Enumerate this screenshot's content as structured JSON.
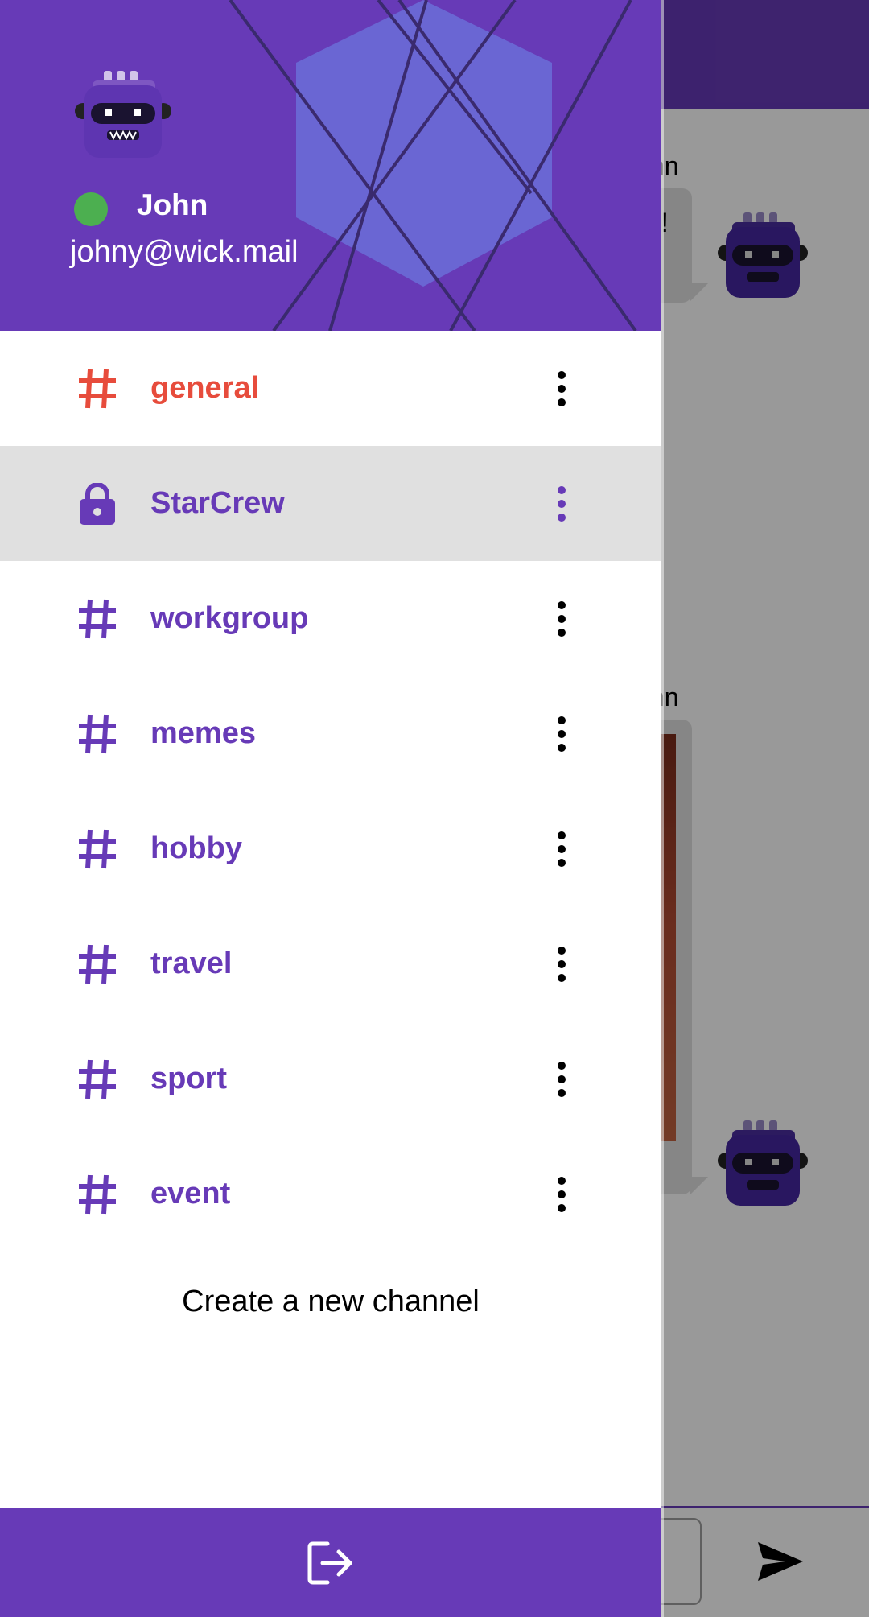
{
  "user": {
    "name": "John",
    "email": "johny@wick.mail",
    "status": "online",
    "avatar_icon": "robot-avatar-icon"
  },
  "channels": [
    {
      "label": "general",
      "icon": "hashtag-icon",
      "color": "#e74c3c",
      "selected": false
    },
    {
      "label": "StarCrew",
      "icon": "lock-icon",
      "color": "#673ab7",
      "selected": true
    },
    {
      "label": "workgroup",
      "icon": "hashtag-icon",
      "color": "#673ab7",
      "selected": false
    },
    {
      "label": "memes",
      "icon": "hashtag-icon",
      "color": "#673ab7",
      "selected": false
    },
    {
      "label": "hobby",
      "icon": "hashtag-icon",
      "color": "#673ab7",
      "selected": false
    },
    {
      "label": "travel",
      "icon": "hashtag-icon",
      "color": "#673ab7",
      "selected": false
    },
    {
      "label": "sport",
      "icon": "hashtag-icon",
      "color": "#673ab7",
      "selected": false
    },
    {
      "label": "event",
      "icon": "hashtag-icon",
      "color": "#673ab7",
      "selected": false
    }
  ],
  "create_channel_label": "Create a new channel",
  "footer": {
    "icon": "logout-icon"
  },
  "background_chat": {
    "messages": [
      {
        "author_fragment": "hn",
        "text_fragment": "!!"
      },
      {
        "author_fragment": "hn",
        "attachment": "image"
      }
    ],
    "send_icon": "send-icon"
  },
  "colors": {
    "primary": "#673ab7",
    "accent_red": "#e74c3c",
    "online": "#4caf50",
    "selected_row": "#e0e0e0"
  }
}
